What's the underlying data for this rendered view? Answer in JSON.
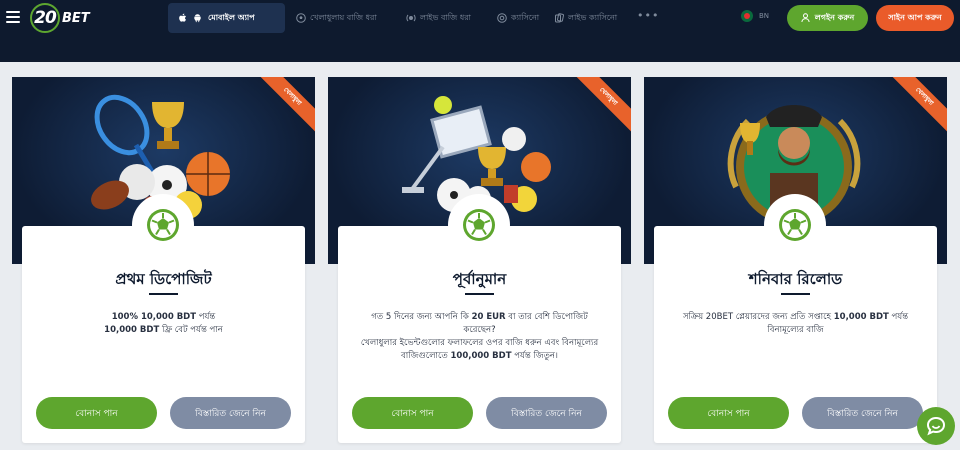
{
  "header": {
    "logo_number": "20",
    "logo_text": "BET",
    "mobile_app_label": "মোবাইল অ্যাপ",
    "nav": [
      {
        "label": "খেলাধুলায় বাজি ধরা",
        "icon": "soccer-ball-icon"
      },
      {
        "label": "লাইভ বাজি ধরা",
        "icon": "live-icon"
      },
      {
        "label": "ক্যাসিনো",
        "icon": "casino-chip-icon"
      },
      {
        "label": "লাইভ ক্যাসিনো",
        "icon": "cards-icon"
      }
    ],
    "more_label": "•••",
    "lang_label": "BN",
    "login_label": "লগইন করুন",
    "signup_label": "সাইন আপ করুন"
  },
  "cards": [
    {
      "ribbon": "খেলাধুলা",
      "title": "প্রথম ডিপোজিট",
      "desc_line1_bold": "100% 10,000 BDT",
      "desc_line1": " পর্যন্ত",
      "desc_line2_bold": "10,000 BDT",
      "desc_line2": " ফ্রি বেট পর্যন্ত পান",
      "bonus_label": "বোনাস পান",
      "details_label": "বিস্তারিত জেনে নিন"
    },
    {
      "ribbon": "খেলাধুলা",
      "title": "পূর্বানুমান",
      "desc_part1": "গত 5 দিনের জন্য আপনি কি ",
      "desc_bold1": "20 EUR",
      "desc_part2": " বা তার বেশি ডিপোজিট করেছেন?",
      "desc_part3": "খেলাধুলার ইভেন্টগুলোর ফলাফলের ওপর বাজি ধরুন এবং বিনামূল্যের বাজিগুলোতে ",
      "desc_bold2": "100,000 BDT",
      "desc_part4": " পর্যন্ত জিতুন।",
      "bonus_label": "বোনাস পান",
      "details_label": "বিস্তারিত জেনে নিন"
    },
    {
      "ribbon": "খেলাধুলা",
      "title": "শনিবার রিলোড",
      "desc_part1": "সক্রিয় 20BET প্লেয়ারদের জন্য প্রতি সপ্তাহে ",
      "desc_bold1": "10,000 BDT",
      "desc_part2": " পর্যন্ত বিনামূল্যের বাজি",
      "bonus_label": "বোনাস পান",
      "details_label": "বিস্তারিত জেনে নিন"
    }
  ],
  "colors": {
    "header_bg": "#0e1a2e",
    "green": "#5ea62e",
    "orange": "#ea5b2a",
    "gray_button": "#7f8ca4",
    "page_bg": "#e9ecf0"
  },
  "chat_icon": "chat-bubble-icon"
}
